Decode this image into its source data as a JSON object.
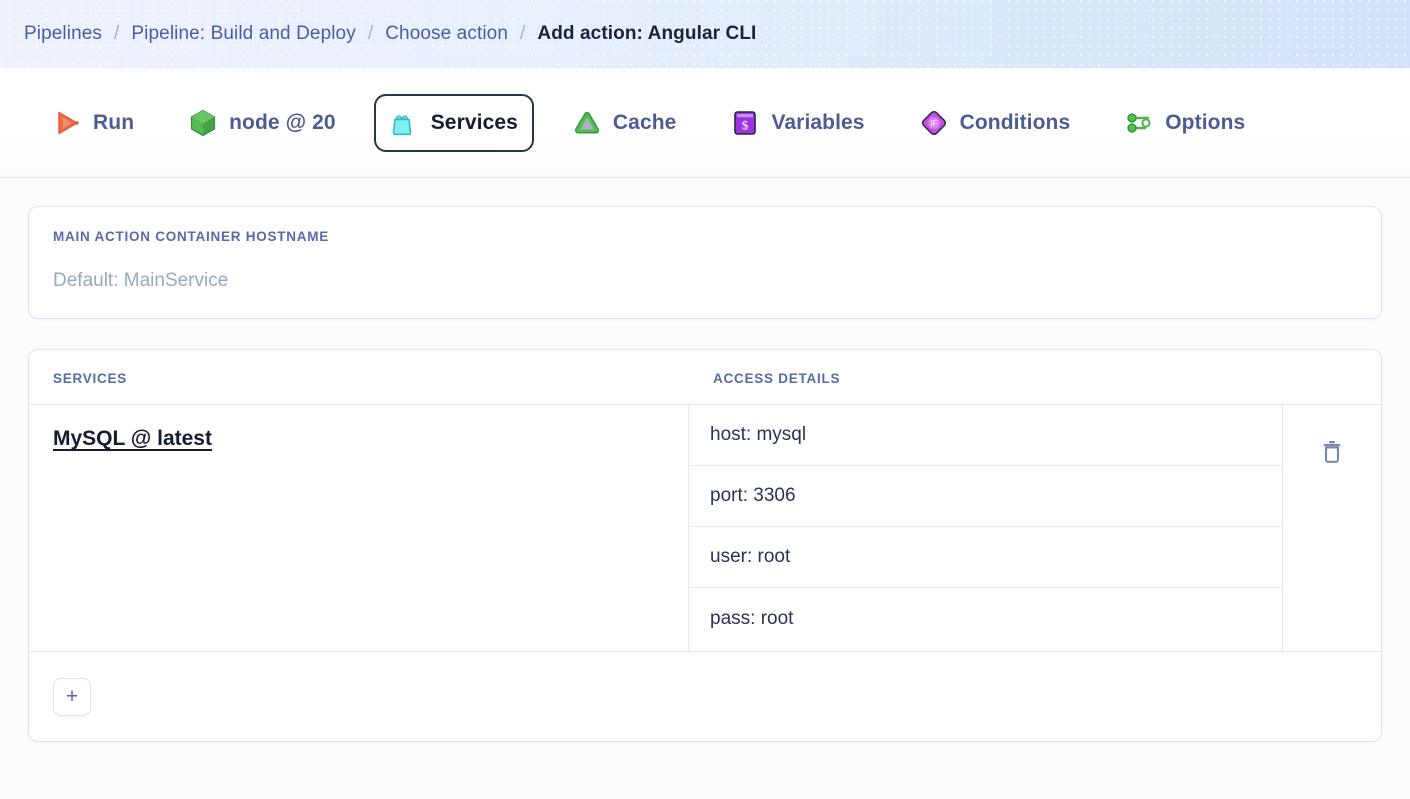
{
  "breadcrumb": {
    "separator": "/",
    "items": [
      {
        "label": "Pipelines",
        "current": false
      },
      {
        "label": "Pipeline: Build and Deploy",
        "current": false
      },
      {
        "label": "Choose action",
        "current": false
      },
      {
        "label": "Add action: Angular CLI",
        "current": true
      }
    ]
  },
  "tabs": [
    {
      "label": "Run",
      "icon": "play-icon",
      "active": false
    },
    {
      "label": "node @ 20",
      "icon": "node-cube-icon",
      "active": false
    },
    {
      "label": "Services",
      "icon": "services-bag-icon",
      "active": true
    },
    {
      "label": "Cache",
      "icon": "cache-triangle-icon",
      "active": false
    },
    {
      "label": "Variables",
      "icon": "variables-dollar-icon",
      "active": false
    },
    {
      "label": "Conditions",
      "icon": "conditions-if-icon",
      "active": false
    },
    {
      "label": "Options",
      "icon": "options-sliders-icon",
      "active": false
    }
  ],
  "hostname": {
    "label": "MAIN ACTION CONTAINER HOSTNAME",
    "placeholder": "Default: MainService",
    "value": ""
  },
  "services_table": {
    "columns": [
      "SERVICES",
      "ACCESS DETAILS"
    ],
    "rows": [
      {
        "name": "MySQL @ latest",
        "details": [
          "host: mysql",
          "port: 3306",
          "user: root",
          "pass: root"
        ],
        "delete_icon": "trash-icon"
      }
    ],
    "add_button_label": "+",
    "add_button_icon": "plus-icon"
  },
  "colors": {
    "breadcrumb_link": "#4c5ba8",
    "breadcrumb_current": "#1b2240",
    "tab_label": "#4e5b93",
    "tab_active_label": "#161c2f",
    "tab_active_border": "#2b3348",
    "field_label": "#5a6aa8",
    "placeholder": "#9aa6c4",
    "card_border": "#dbe3f4",
    "page_bg": "#fbfcfe",
    "accent_run": "#ef6a45",
    "accent_node": "#3fa33f",
    "accent_services": "#5fe4e4",
    "accent_cache": "#46b34a",
    "accent_variables": "#8e3ddc",
    "accent_conditions": "#c243dc",
    "accent_options": "#41b441"
  }
}
